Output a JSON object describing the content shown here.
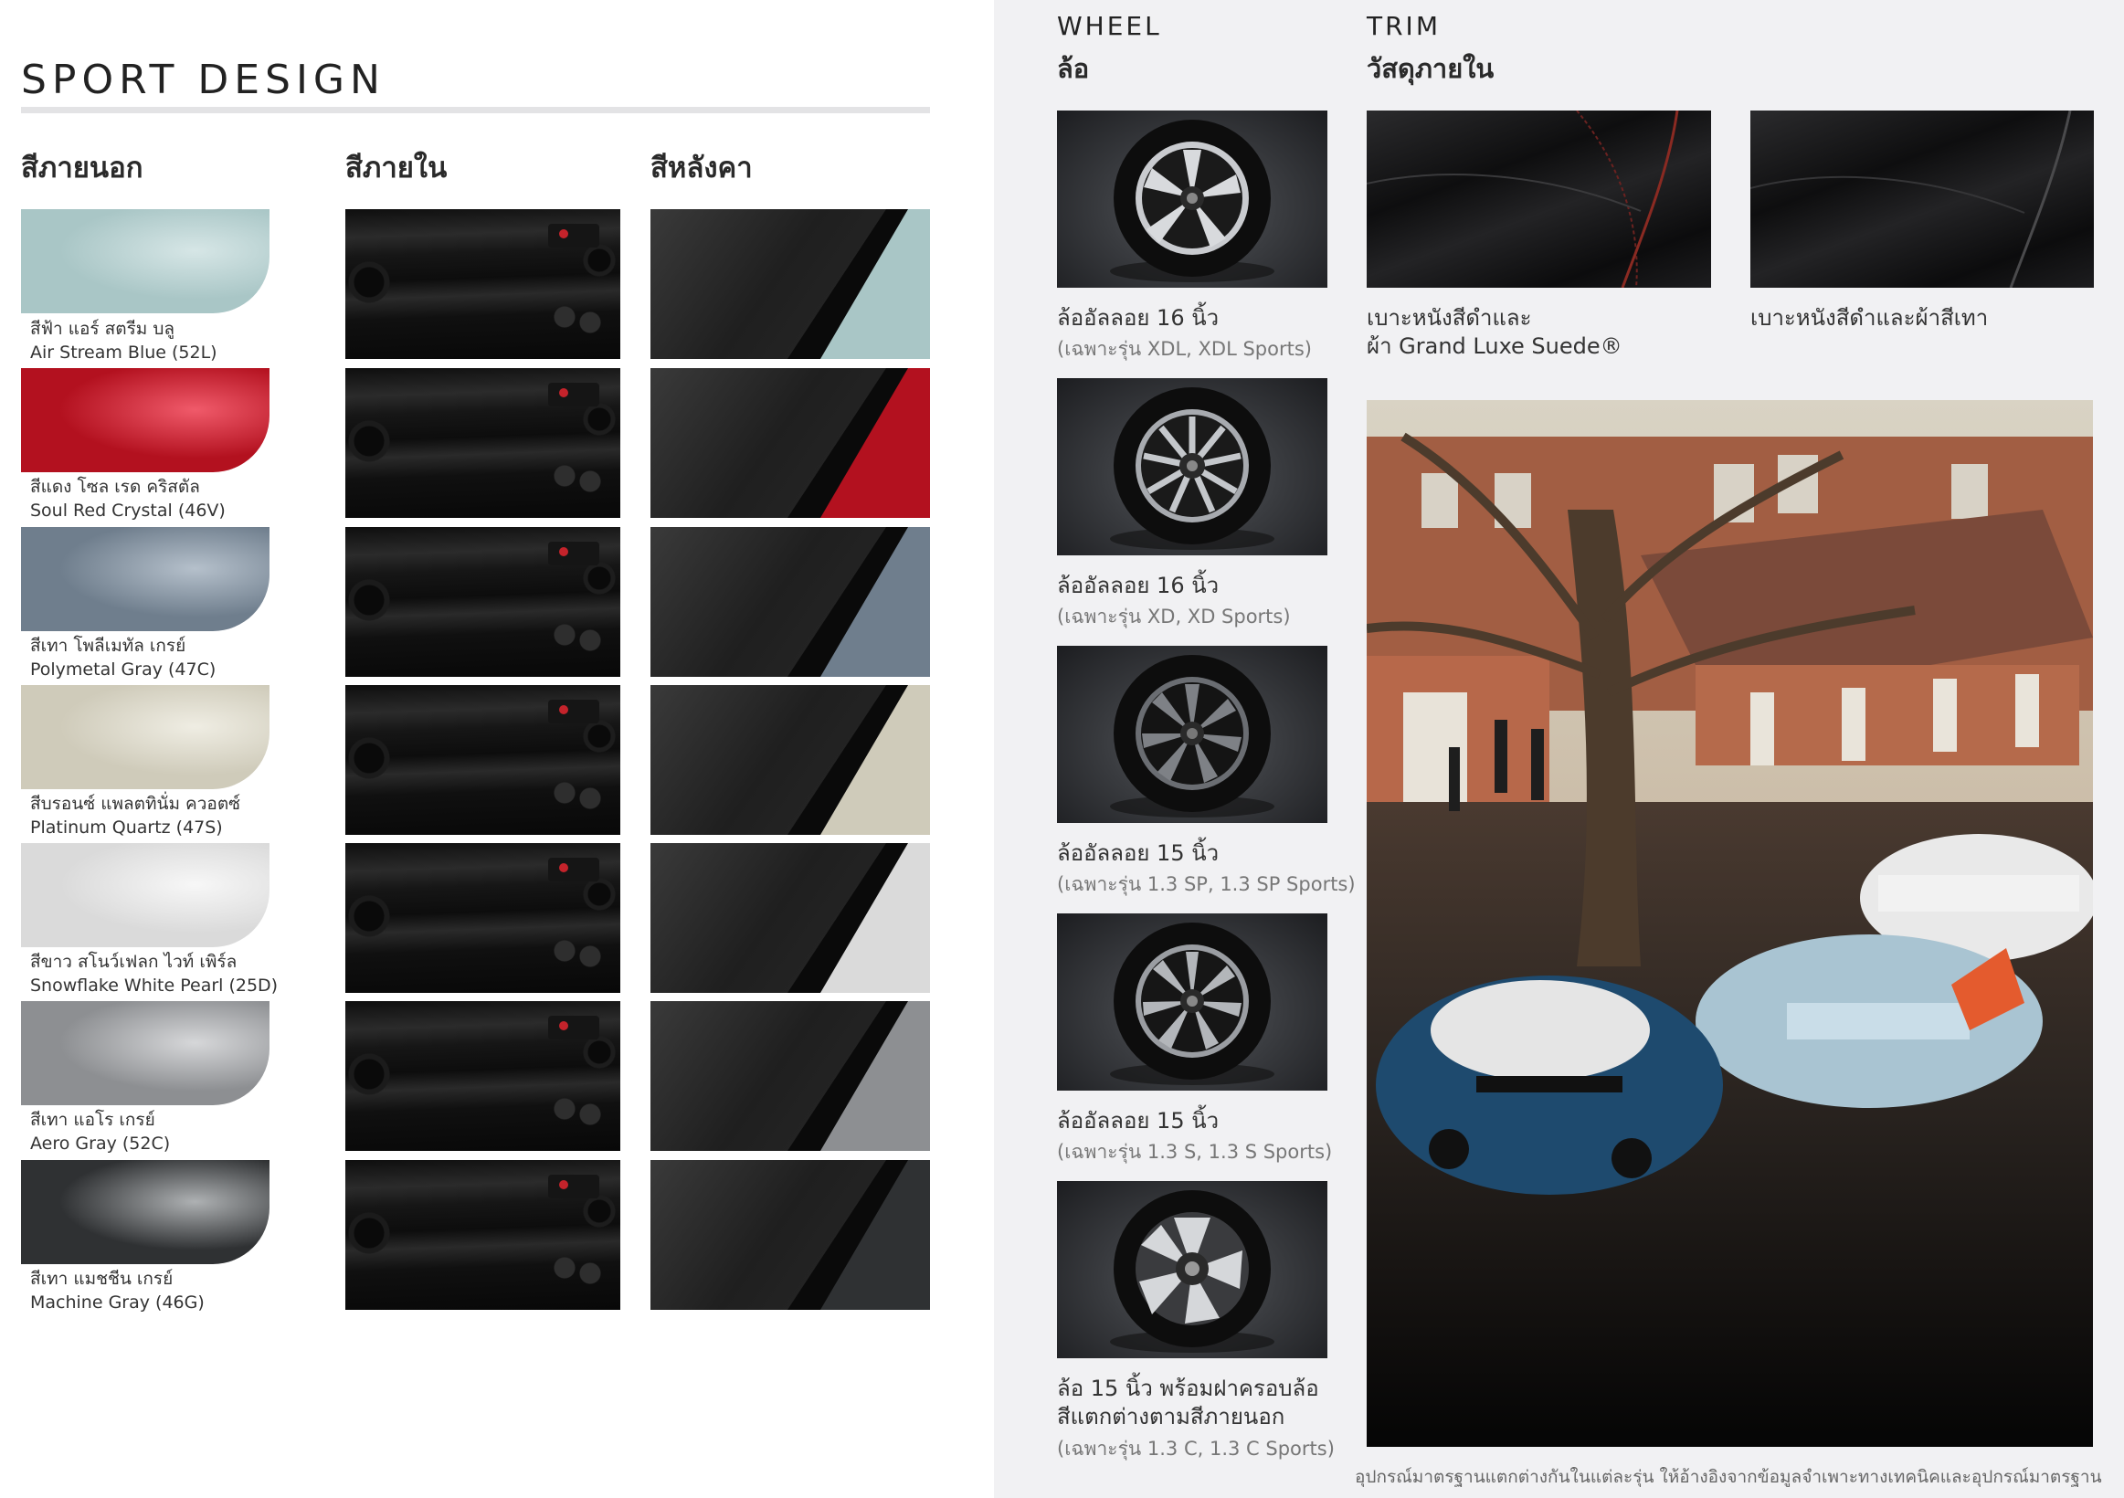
{
  "page_title": "SPORT DESIGN",
  "columns": {
    "exterior": "สีภายนอก",
    "interior": "สีภายใน",
    "roof": "สีหลังคา"
  },
  "colors": [
    {
      "thai": "สีฟ้า แอร์ สตรีม บลู",
      "name": "Air Stream Blue (52L)",
      "hex": "#a9c6c6",
      "hex_light": "#d6e6e6"
    },
    {
      "thai": "สีแดง โซล เรด คริสตัล",
      "name": "Soul Red Crystal (46V)",
      "hex": "#b3111f",
      "hex_light": "#f05a6a"
    },
    {
      "thai": "สีเทา โพลีเมทัล เกรย์",
      "name": "Polymetal Gray (47C)",
      "hex": "#6f7e8d",
      "hex_light": "#b5c0cb"
    },
    {
      "thai": "สีบรอนซ์ แพลตทินั่ม ควอตซ์",
      "name": "Platinum Quartz (47S)",
      "hex": "#cfcbba",
      "hex_light": "#efede3"
    },
    {
      "thai": "สีขาว สโนว์เฟลก ไวท์ เพิร์ล",
      "name": "Snowflake White Pearl (25D)",
      "hex": "#dadada",
      "hex_light": "#f7f7f7"
    },
    {
      "thai": "สีเทา แอโร เกรย์",
      "name": "Aero Gray (52C)",
      "hex": "#8d8f92",
      "hex_light": "#d6d7d9"
    },
    {
      "thai": "สีเทา แมชชีน เกรย์",
      "name": "Machine Gray (46G)",
      "hex": "#2f3133",
      "hex_light": "#aeb1b3"
    }
  ],
  "wheel": {
    "heading": "WHEEL",
    "subheading": "ล้อ",
    "items": [
      {
        "label": "ล้ออัลลอย 16 นิ้ว",
        "note": "(เฉพาะรุ่น XDL, XDL Sports)"
      },
      {
        "label": "ล้ออัลลอย 16 นิ้ว",
        "note": "(เฉพาะรุ่น XD, XD Sports)"
      },
      {
        "label": "ล้ออัลลอย 15 นิ้ว",
        "note": "(เฉพาะรุ่น 1.3 SP, 1.3 SP Sports)"
      },
      {
        "label": "ล้ออัลลอย 15 นิ้ว",
        "note": "(เฉพาะรุ่น 1.3 S, 1.3 S Sports)"
      },
      {
        "label": "ล้อ 15 นิ้ว พร้อมฝาครอบล้อ",
        "label2": "สีแตกต่างตามสีภายนอก",
        "note": "(เฉพาะรุ่น 1.3 C, 1.3 C Sports)"
      }
    ]
  },
  "trim": {
    "heading": "TRIM",
    "subheading": "วัสดุภายใน",
    "items": [
      {
        "line1": "เบาะหนังสีดำและ",
        "line2": "ผ้า Grand Luxe Suede®"
      },
      {
        "line1": "เบาะหนังสีดำและผ้าสีเทา",
        "line2": ""
      }
    ]
  },
  "footnote": "อุปกรณ์มาตรฐานแตกต่างกันในแต่ละรุ่น ให้อ้างอิงจากข้อมูลจำเพาะทางเทคนิคและอุปกรณ์มาตรฐาน"
}
